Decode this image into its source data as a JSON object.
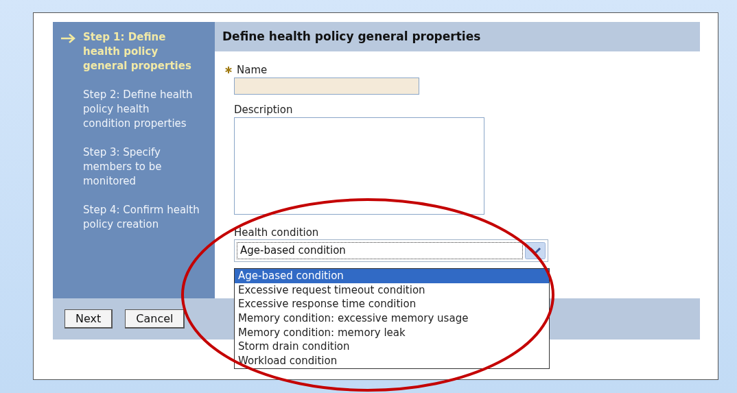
{
  "steps": [
    {
      "label": "Step 1: Define health policy general properties",
      "selected": true
    },
    {
      "label": "Step 2: Define health policy health condition properties",
      "selected": false
    },
    {
      "label": "Step 3: Specify members to be monitored",
      "selected": false
    },
    {
      "label": "Step 4: Confirm health policy creation",
      "selected": false
    }
  ],
  "panel_title": "Define health policy general properties",
  "name_field": {
    "label": "Name",
    "required": true
  },
  "description_field": {
    "label": "Description"
  },
  "health_condition": {
    "label": "Health condition",
    "value": "Age-based condition",
    "expanded": true,
    "options": [
      {
        "label": "Age-based condition",
        "selected": true
      },
      {
        "label": "Excessive request timeout condition",
        "selected": false
      },
      {
        "label": "Excessive response time condition",
        "selected": false
      },
      {
        "label": "Memory condition: excessive memory usage",
        "selected": false
      },
      {
        "label": "Memory condition: memory leak",
        "selected": false
      },
      {
        "label": "Storm drain condition",
        "selected": false
      },
      {
        "label": "Workload condition",
        "selected": false
      }
    ]
  },
  "buttons": [
    "Next",
    "Cancel"
  ]
}
